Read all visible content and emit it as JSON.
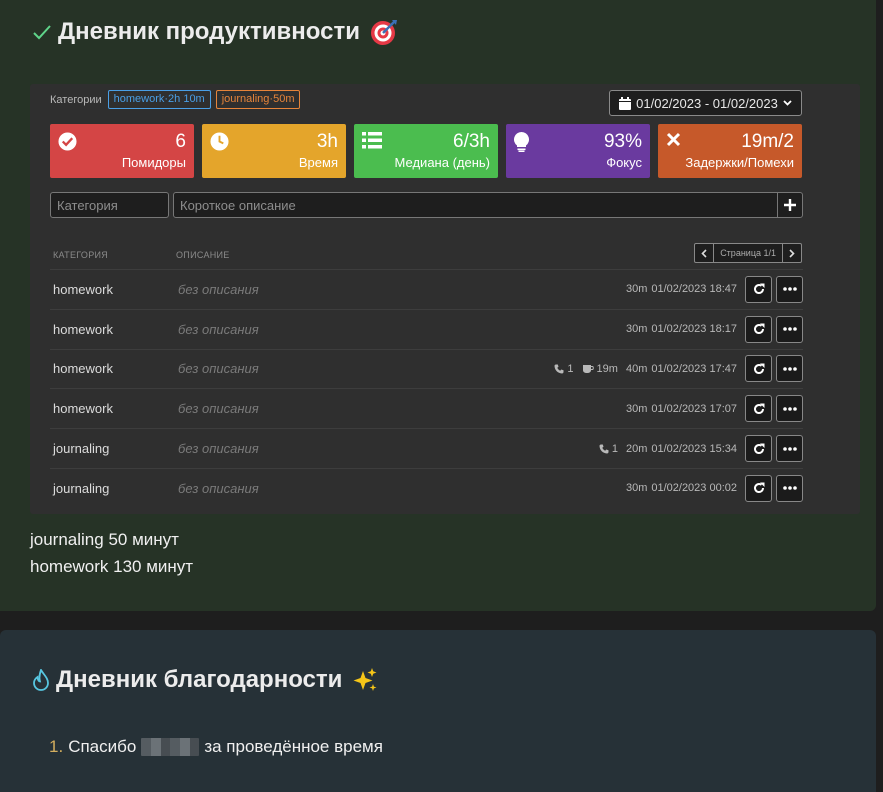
{
  "productivity": {
    "title": "Дневник продуктивности",
    "categories_label": "Категории",
    "tags": [
      {
        "text": "homework·2h 10m",
        "color": "#4a9fe6"
      },
      {
        "text": "journaling·50m",
        "color": "#e6843a"
      }
    ],
    "date_range": "01/02/2023 - 01/02/2023",
    "cards": [
      {
        "value": "6",
        "label": "Помидоры",
        "icon": "check-circle-icon",
        "color": "#d44545"
      },
      {
        "value": "3h",
        "label": "Время",
        "icon": "clock-icon",
        "color": "#e4a52b"
      },
      {
        "value": "6/3h",
        "label": "Медиана (день)",
        "icon": "list-icon",
        "color": "#4bbd4f"
      },
      {
        "value": "93%",
        "label": "Фокус",
        "icon": "lightbulb-icon",
        "color": "#6a3a9f"
      },
      {
        "value": "19m/2",
        "label": "Задержки/Помехи",
        "icon": "x-icon",
        "color": "#c6592a"
      }
    ],
    "category_placeholder": "Категория",
    "description_placeholder": "Короткое описание",
    "table": {
      "col_category": "КАТЕГОРИЯ",
      "col_description": "ОПИСАНИЕ",
      "page_label": "Страница 1/1",
      "rows": [
        {
          "category": "homework",
          "description": "без описания",
          "calls": "",
          "breaks": "",
          "duration": "30m",
          "time": "01/02/2023 18:47"
        },
        {
          "category": "homework",
          "description": "без описания",
          "calls": "",
          "breaks": "",
          "duration": "30m",
          "time": "01/02/2023 18:17"
        },
        {
          "category": "homework",
          "description": "без описания",
          "calls": "1",
          "breaks": "19m",
          "duration": "40m",
          "time": "01/02/2023 17:47"
        },
        {
          "category": "homework",
          "description": "без описания",
          "calls": "",
          "breaks": "",
          "duration": "30m",
          "time": "01/02/2023 17:07"
        },
        {
          "category": "journaling",
          "description": "без описания",
          "calls": "1",
          "breaks": "",
          "duration": "20m",
          "time": "01/02/2023 15:34"
        },
        {
          "category": "journaling",
          "description": "без описания",
          "calls": "",
          "breaks": "",
          "duration": "30m",
          "time": "01/02/2023 00:02"
        }
      ]
    },
    "summary": [
      "journaling 50 минут",
      "homework 130 минут"
    ]
  },
  "gratitude": {
    "title": "Дневник благодарности",
    "items": [
      {
        "number": "1.",
        "before": "Спасибо",
        "after": "за проведённое время"
      }
    ]
  }
}
